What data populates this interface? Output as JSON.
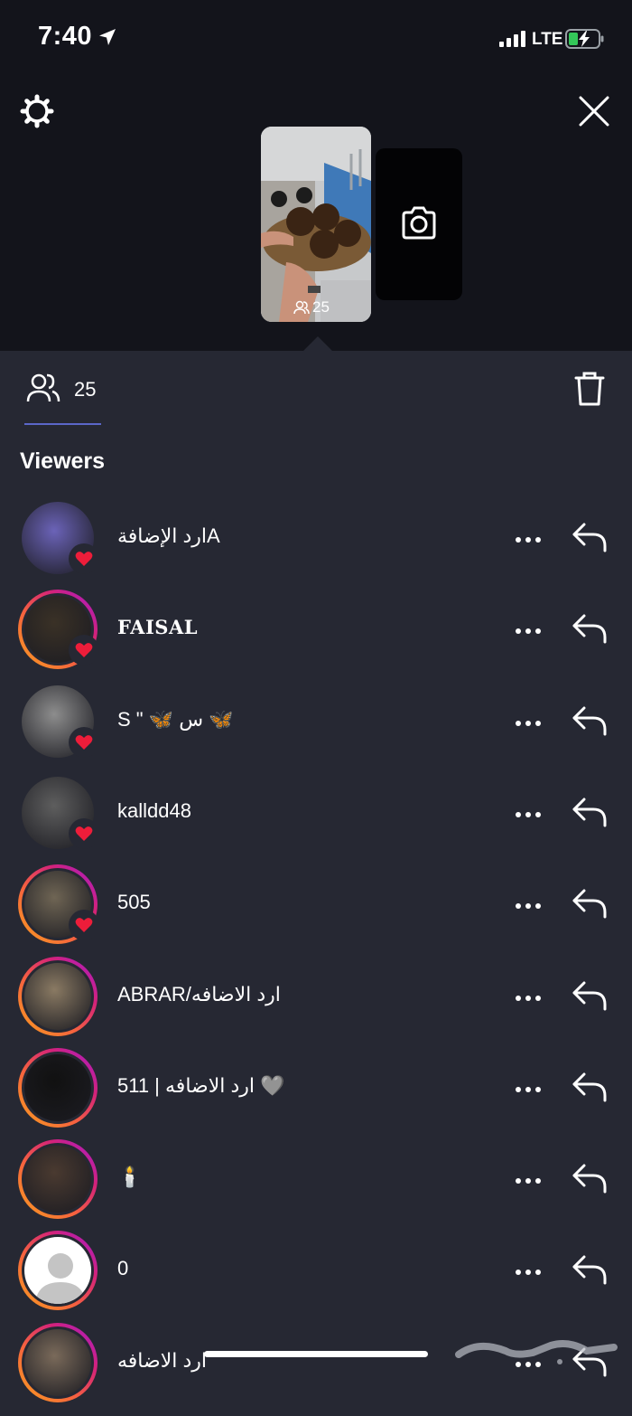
{
  "status_bar": {
    "time": "7:40",
    "network": "LTE"
  },
  "story": {
    "viewer_count": "25"
  },
  "tabs": {
    "viewer_count": "25"
  },
  "section": {
    "title": "Viewers"
  },
  "viewers": [
    {
      "name": "ارد الإضافةA",
      "liked": true,
      "ring": false
    },
    {
      "name": "FAISAL",
      "liked": true,
      "ring": true
    },
    {
      "name": "S \" 🦋 س 🦋",
      "liked": true,
      "ring": false
    },
    {
      "name": "kalldd48",
      "liked": true,
      "ring": false
    },
    {
      "name": "505",
      "liked": true,
      "ring": true
    },
    {
      "name": "ABRAR/ارد الاضافه",
      "liked": false,
      "ring": true
    },
    {
      "name": "511 | ارد الاضافه 🩶",
      "liked": false,
      "ring": true
    },
    {
      "name": "🕯️",
      "liked": false,
      "ring": true
    },
    {
      "name": "0",
      "liked": false,
      "ring": true
    },
    {
      "name": "ارد الاضافه",
      "liked": false,
      "ring": true
    }
  ],
  "colors": {
    "background": "#262833",
    "top_background": "#13141b",
    "heart": "#ed1d3a",
    "tab_indicator": "#5b67c9"
  },
  "watermark": "حراج"
}
